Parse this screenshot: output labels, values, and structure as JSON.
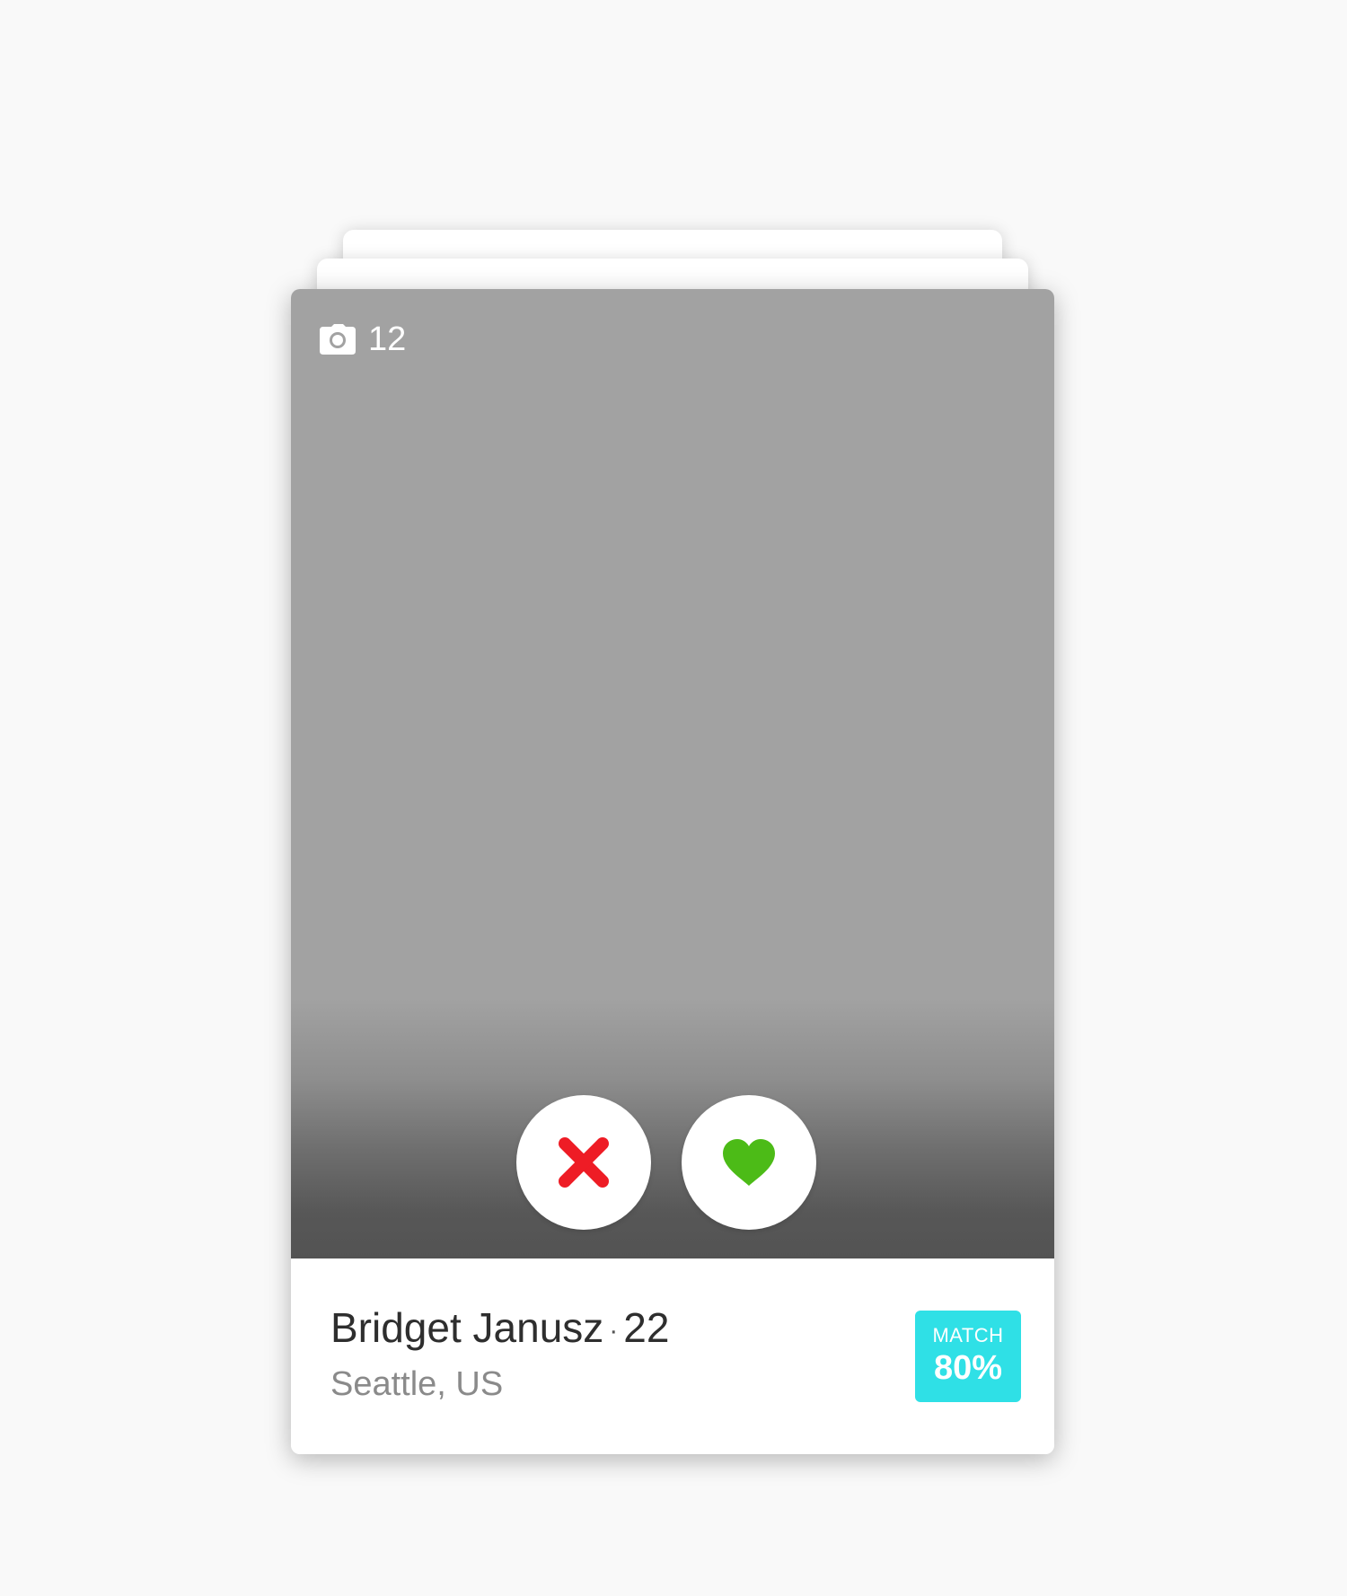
{
  "card_stack": {
    "photo_count": "12",
    "profile": {
      "name": "Bridget Janusz",
      "separator": "·",
      "age": "22",
      "location": "Seattle, US"
    },
    "match": {
      "label": "MATCH",
      "value": "80%"
    },
    "actions": {
      "dislike_icon": "close-x-icon",
      "like_icon": "heart-icon"
    }
  },
  "colors": {
    "background": "#f9f9f9",
    "photo_placeholder": "#a2a2a2",
    "dislike": "#ee1c25",
    "like": "#4cbb17",
    "match_badge": "#2fe0e6",
    "name_text": "#2e2e2e",
    "location_text": "#8a8a8a"
  }
}
